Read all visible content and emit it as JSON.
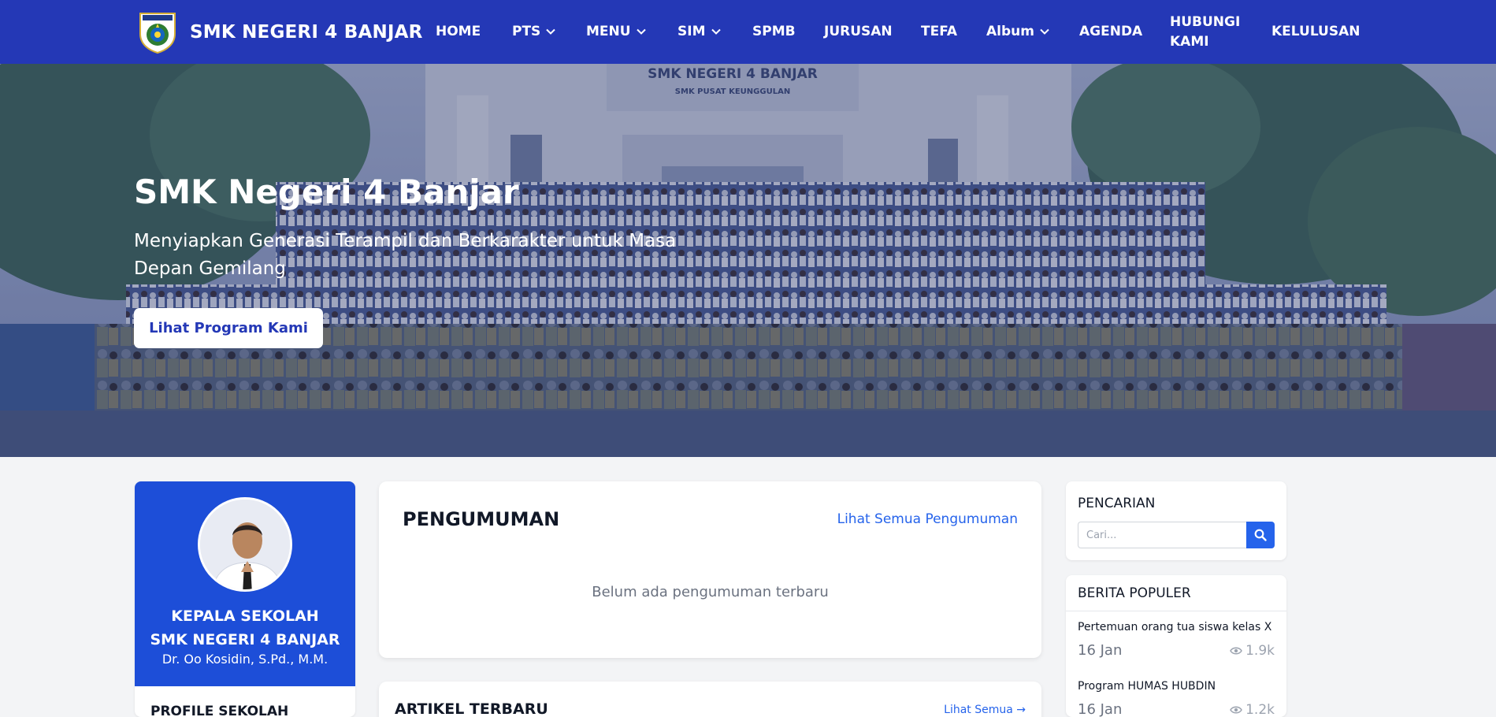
{
  "brand": {
    "name": "SMK NEGERI 4 BANJAR"
  },
  "nav": {
    "home": "HOME",
    "pts": "PTS",
    "menu": "MENU",
    "sim": "SIM",
    "spmb": "SPMB",
    "jurusan": "JURUSAN",
    "tefa": "TEFA",
    "album": "Album",
    "agenda": "AGENDA",
    "hubungi_line1": "HUBUNGI",
    "hubungi_line2": "KAMI",
    "kelulusan": "KELULUSAN"
  },
  "hero": {
    "title": "SMK Negeri 4 Banjar",
    "subtitle": "Menyiapkan Generasi Terampil dan Berkarakter untuk Masa Depan Gemilang",
    "cta": "Lihat Program Kami",
    "building_sign": "SMK NEGERI 4 BANJAR",
    "building_sub": "SMK PUSAT KEUNGGULAN"
  },
  "principal": {
    "role_line1": "KEPALA SEKOLAH",
    "role_line2": "SMK NEGERI 4 BANJAR",
    "name": "Dr. Oo Kosidin, S.Pd., M.M.",
    "profile_heading": "PROFILE SEKOLAH"
  },
  "announcements": {
    "title": "PENGUMUMAN",
    "link": "Lihat Semua Pengumuman",
    "empty": "Belum ada pengumuman terbaru"
  },
  "articles": {
    "title": "ARTIKEL TERBARU",
    "link": "Lihat Semua →"
  },
  "search": {
    "title": "PENCARIAN",
    "placeholder": "Cari..."
  },
  "popular": {
    "title": "BERITA POPULER",
    "items": [
      {
        "title": "Pertemuan orang tua siswa kelas X",
        "date": "16 Jan",
        "views": "1.9k"
      },
      {
        "title": "Program HUMAS HUBDIN",
        "date": "16 Jan",
        "views": "1.2k"
      }
    ]
  },
  "colors": {
    "navbar": "#2438b6",
    "accent": "#1d4ed8",
    "link": "#2563eb"
  }
}
